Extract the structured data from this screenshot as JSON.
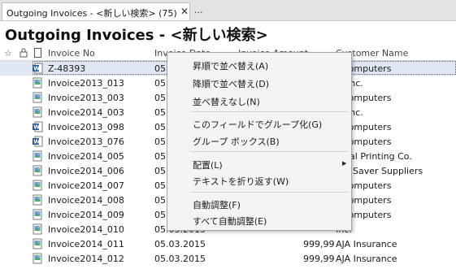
{
  "tab": {
    "label": "Outgoing Invoices - <新しい検索> (75)",
    "close": "✕",
    "more": "..."
  },
  "page_title": "Outgoing Invoices - <新しい検索>",
  "columns": {
    "no": "Invoice No",
    "date": "Invoice Date",
    "amount": "Invoice Amount",
    "customer": "Customer Name"
  },
  "header_icons": {
    "star": "☆",
    "lock": "🔒",
    "doc": "▯"
  },
  "rows": [
    {
      "no": "Z-48393",
      "date": "05.0",
      "amount": "",
      "customer": "r Computers",
      "icon": "word-doc-icon"
    },
    {
      "no": "Invoice2013_013",
      "date": "05.0",
      "amount": "",
      "customer": "1, Inc.",
      "icon": "image-doc-icon"
    },
    {
      "no": "Invoice2013_003",
      "date": "05.0",
      "amount": "",
      "customer": "r Computers",
      "icon": "image-doc-icon"
    },
    {
      "no": "Invoice2014_003",
      "date": "05.0",
      "amount": "",
      "customer": "1, Inc.",
      "icon": "image-doc-icon"
    },
    {
      "no": "Invoice2013_098",
      "date": "05.0",
      "amount": "",
      "customer": "r Computers",
      "icon": "word-doc-icon"
    },
    {
      "no": "Invoice2013_076",
      "date": "05.0",
      "amount": "",
      "customer": "r Computers",
      "icon": "word-doc-icon"
    },
    {
      "no": "Invoice2014_005",
      "date": "05.0",
      "amount": "",
      "customer": "ersal Printing Co.",
      "icon": "image-doc-icon"
    },
    {
      "no": "Invoice2014_006",
      "date": "05.0",
      "amount": "",
      "customer": "Per Saver Suppliers",
      "icon": "image-doc-icon"
    },
    {
      "no": "Invoice2014_007",
      "date": "05.0",
      "amount": "",
      "customer": "r Computers",
      "icon": "image-doc-icon"
    },
    {
      "no": "Invoice2014_008",
      "date": "05.0",
      "amount": "",
      "customer": "r Computers",
      "icon": "image-doc-icon"
    },
    {
      "no": "Invoice2014_009",
      "date": "05.0",
      "amount": "",
      "customer": "r Computers",
      "icon": "image-doc-icon"
    },
    {
      "no": "Invoice2014_010",
      "date": "05.03.2015",
      "amount": "",
      "customer": "Inc.",
      "icon": "image-doc-icon"
    },
    {
      "no": "Invoice2014_011",
      "date": "05.03.2015",
      "amount": "999,99",
      "customer": "AJA Insurance",
      "icon": "image-doc-icon"
    },
    {
      "no": "Invoice2014_012",
      "date": "05.03.2015",
      "amount": "999,99",
      "customer": "AJA Insurance",
      "icon": "image-doc-icon"
    }
  ],
  "context_menu": {
    "items": [
      {
        "label": "昇順で並べ替え(A)"
      },
      {
        "label": "降順で並べ替え(D)"
      },
      {
        "label": "並べ替えなし(N)"
      },
      {
        "label": "このフィールドでグループ化(G)"
      },
      {
        "label": "グループ ボックス(B)"
      },
      {
        "label": "配置(L)"
      },
      {
        "label": "テキストを折り返す(W)"
      },
      {
        "label": "自動調整(F)"
      },
      {
        "label": "すべて自動調整(E)"
      }
    ],
    "submenu_arrow": "▶"
  },
  "colors": {
    "selection": "#dfe7f2",
    "menu_bg": "#f4f4f4",
    "word_blue": "#2b5797"
  }
}
